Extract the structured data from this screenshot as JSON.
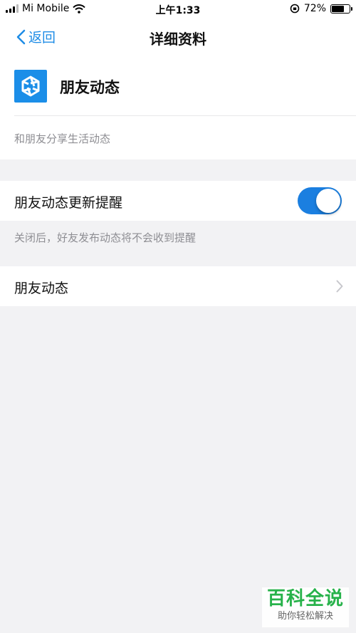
{
  "status_bar": {
    "carrier": "Mi Mobile",
    "time": "上午1:33",
    "battery": "72%",
    "battery_level": 0.72
  },
  "nav": {
    "back_label": "返回",
    "title": "详细资料"
  },
  "app": {
    "name": "朋友动态",
    "description": "和朋友分享生活动态",
    "icon": "aperture-icon"
  },
  "settings": {
    "toggle_label": "朋友动态更新提醒",
    "toggle_on": true,
    "hint": "关闭后，好友发布动态将不会收到提醒",
    "link_label": "朋友动态"
  },
  "watermark": {
    "main": "百科全说",
    "sub": "助你轻松解决"
  },
  "colors": {
    "accent": "#1b7fe0",
    "watermark_green": "#27b24a"
  }
}
